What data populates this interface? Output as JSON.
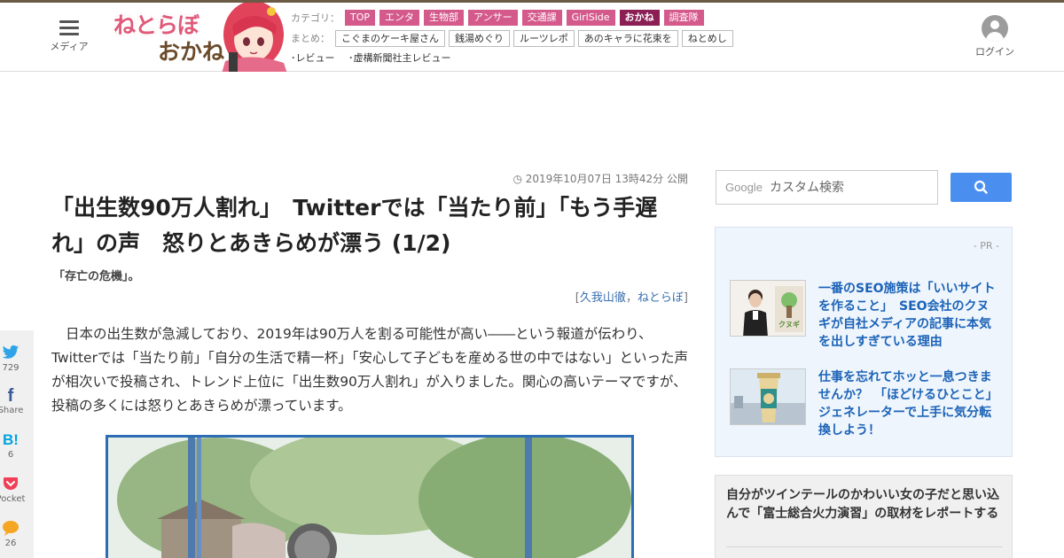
{
  "header": {
    "menu_label": "メディア",
    "logo": {
      "text_line1": "ねとらぼ",
      "text_line2": "おかね"
    },
    "category_label": "カテゴリ：",
    "categories": [
      {
        "label": "TOP",
        "active": false
      },
      {
        "label": "エンタ",
        "active": false
      },
      {
        "label": "生物部",
        "active": false
      },
      {
        "label": "アンサー",
        "active": false
      },
      {
        "label": "交通課",
        "active": false
      },
      {
        "label": "GirlSide",
        "active": false
      },
      {
        "label": "おかね",
        "active": true
      },
      {
        "label": "調査隊",
        "active": false
      }
    ],
    "summary_label": "まとめ：",
    "summaries": [
      "こぐまのケーキ屋さん",
      "銭湯めぐり",
      "ルーツレポ",
      "あのキャラに花束を",
      "ねとめし"
    ],
    "reviews": [
      "･レビュー",
      "･虚構新聞社主レビュー"
    ],
    "login_label": "ログイン"
  },
  "article": {
    "date": "2019年10月07日 13時42分 公開",
    "title": "「出生数90万人割れ」　Twitterでは「当たり前」「もう手遅れ」の声　怒りとあきらめが漂う (1/2)",
    "subtitle": "「存亡の危機」。",
    "byline_open": "[",
    "author": "久我山徹",
    "byline_sep": "，",
    "outlet": "ねとらぼ",
    "byline_close": "]",
    "body": "日本の出生数が急減しており、2019年は90万人を割る可能性が高い――という報道が伝わり、Twitterでは「当たり前」「自分の生活で精一杯」「安心して子どもを産める世の中ではない」といった声が相次いで投稿され、トレンド上位に「出生数90万人割れ」が入りました。関心の高いテーマですが、投稿の多くには怒りとあきらめが漂っています。"
  },
  "share": [
    {
      "icon": "twitter-icon",
      "count": "729"
    },
    {
      "icon": "facebook-icon",
      "count": "Share"
    },
    {
      "icon": "hatena-bookmark-icon",
      "count": "6"
    },
    {
      "icon": "pocket-icon",
      "count": "Pocket"
    },
    {
      "icon": "comment-icon",
      "count": "26"
    }
  ],
  "sidebar": {
    "search": {
      "brand": "Google",
      "placeholder": "カスタム検索"
    },
    "pr_label": "- PR -",
    "pr_items": [
      {
        "text": "一番のSEO施策は「いいサイトを作ること」　SEO会社のクヌギが自社メディアの記事に本気を出しすぎている理由",
        "thumb_caption": "クヌギ"
      },
      {
        "text": "仕事を忘れてホッと一息つきませんか？　「ほどけるひとこと」ジェネレーターで上手に気分転換しよう！"
      }
    ],
    "ranking_item": "自分がツインテールのかわいい女の子だと思い込んで「富士総合火力演習」の取材をレポートする"
  },
  "colors": {
    "category_bg": "#d45a8c",
    "category_active_bg": "#8a1e55",
    "link_blue": "#1c63b8",
    "search_button": "#4a8ff0",
    "photo_border": "#2d6db4",
    "pr_bg": "#eef5fc"
  }
}
